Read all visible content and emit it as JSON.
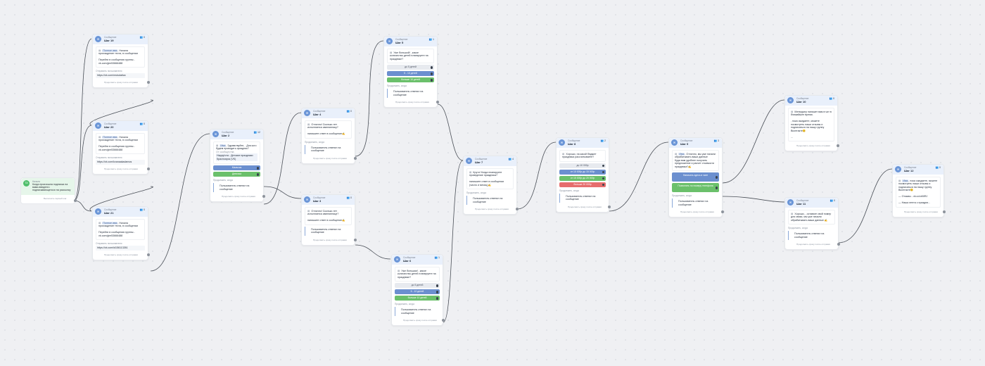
{
  "start": {
    "badge": "ТА",
    "type": "Начало",
    "text": "Когда произошла подписка на вами-введенго подписывающегося на рассылку",
    "footer": "Выполнять первый шаг"
  },
  "common": {
    "type_message": "Сообщение",
    "continue_when": "Продолжить, когда",
    "send_when": "Продолжить сразу после отправки",
    "wait_text": "Пользователь ответил на сообщение",
    "name_tag": "Полное имя",
    "name_short": "Имя",
    "send_user": "Отправить пользователю"
  },
  "nodes": {
    "s19": {
      "title": "Шаг 19",
      "count": "0",
      "text": ", Начала прохождение теста, в сообщении\n\nПерейти в сообщения группы - vk.com/gim53666488",
      "link": "https://vk.com/mstudatica"
    },
    "s20": {
      "title": "Шаг 20",
      "count": "0",
      "text": ", Начала прохождение теста, в сообщении\n\nПерейти в сообщения группы - vk.com/gim53666488",
      "link": "https://vk.com/kvanaakadamos"
    },
    "s21": {
      "title": "Шаг 21",
      "count": "0",
      "text": ", Начала прохождение теста, в сообщении\n\nПерейти в сообщения группы - vk.com/gim53666488",
      "link": "https://vk.com/id156113261"
    },
    "s2": {
      "title": "Шаг 2",
      "count": "12",
      "text": ", Здравствуйте, . Для кого будем проводить праздник?",
      "from": "От сообщества",
      "attach": "Нарру!ота - Детские праздники Красноярск (VK)",
      "buttons": [
        "Мальчик",
        "Девочка"
      ]
    },
    "s4": {
      "title": "Шаг 4",
      "count": "0",
      "text": "Отлично! Сколько лет исполняется имениннику?\n\nнапишите ответ в сообщение✍"
    },
    "s3": {
      "title": "Шаг 3",
      "count": "0",
      "text": "Отлично! Сколько лет исполняется имениннице?\n\nнапишите ответ в сообщение✍"
    },
    "s5": {
      "title": "Шаг 5",
      "count": "1",
      "text": "Уже большой! , какое количество детей планируете на празднике?",
      "buttons": [
        "до 5 детей",
        "5 - 10 детей",
        "больше 10 детей"
      ]
    },
    "s6": {
      "title": "Шаг 6",
      "count": "1",
      "text": "Уже большая! , какое количество детей планируете на празднике?",
      "buttons": [
        "до 5 детей",
        "5 - 10 детей",
        "больше 10 детей"
      ]
    },
    "s7": {
      "title": "Шаг 7",
      "count": "4",
      "text": "Круто! Когда планируете проведение праздника?\n\nнапишите ответ в сообщении (число и месяц)✍"
    },
    "s8": {
      "title": "Шаг 8",
      "count": "2",
      "text": "Хорошо, на какой бюджет праздника рассчитываете?",
      "buttons": [
        "до 10 000р",
        "от 10 000р до 15 000р",
        "от 15 000р до 20 000р",
        "больше 20 000р"
      ]
    },
    "s9": {
      "title": "Шаг 9",
      "count": "3",
      "text": ", Отлично, мы уже начали обрабатывать ваши данные\nКуда вам удобнее получить предложение и расчет стоимости праздника?✍",
      "buttons": [
        "Написать здесь в чате",
        "Позвонить по номеру телефона"
      ]
    },
    "s10": {
      "title": "Шаг 10",
      "count": "0",
      "text": "Менеджер напишет вам в чат в ближайшее время.\n\n, пока ожидаете, можете посмотреть наши отзывы и подписаться на нашу группу Вконтакте😊\n\n..."
    },
    "s11": {
      "title": "Шаг 11",
      "count": "0",
      "text": "Хорошо, , оставьте свой номер для связи, мы уже начали обрабатывать ваши данные ✍"
    },
    "s12": {
      "title": "Шаг 12",
      "count": "0",
      "text": ", пока ожидаете, можете посмотреть наши отзывы и подписаться на нашу группу Вконтакте😊\n\n— Отзывы - vk.cc/cb5IRJ\n\n— Наша лента с праздни..."
    }
  }
}
